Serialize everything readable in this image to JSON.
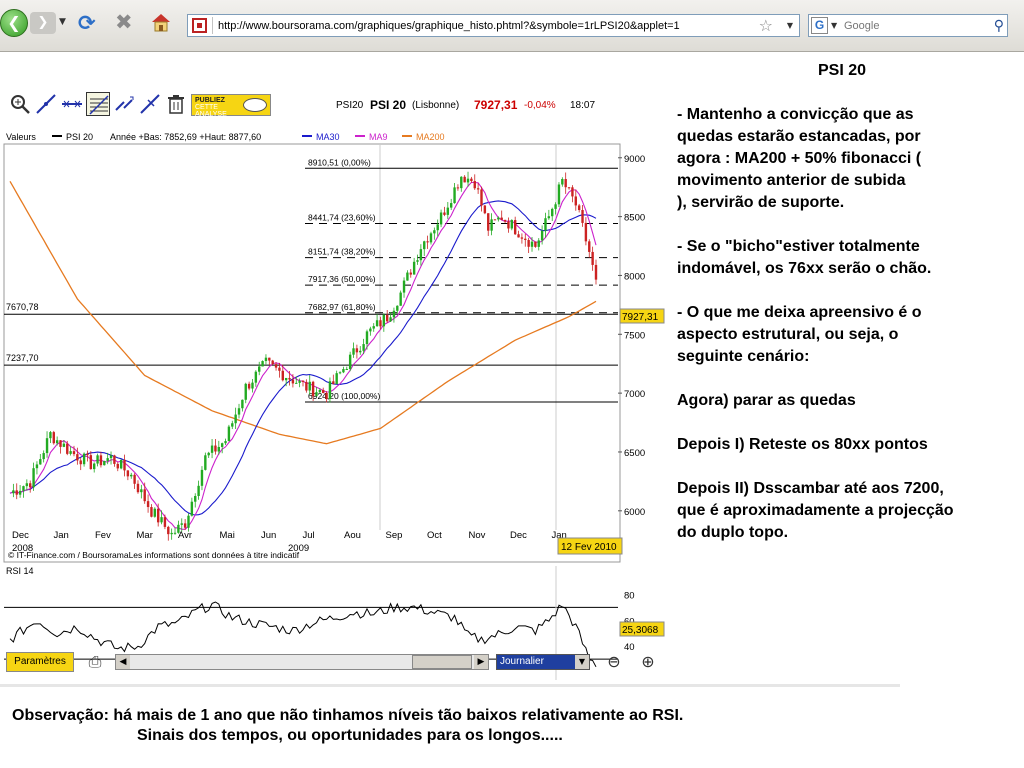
{
  "browser": {
    "url": "http://www.boursorama.com/graphiques/graphique_histo.phtml?&symbole=1rLPSI20&applet=1",
    "search_placeholder": "Google",
    "search_engine_icon": "G"
  },
  "chart_toolbar": {
    "publiez_line1": "PUBLIEZ",
    "publiez_line2": "CETTE",
    "publiez_line3": "ANALYSE",
    "symbol_code": "PSI20",
    "name": "PSI 20",
    "market": "(Lisbonne)",
    "price": "7927,31",
    "change": "-0,04%",
    "time": "18:07",
    "price_color": "#cc0000"
  },
  "chart_bottom": {
    "params_label": "Paramètres",
    "period_value": "Journalier"
  },
  "chart_data": {
    "type": "line",
    "header": {
      "valeurs": "Valeurs",
      "series_name": "PSI 20",
      "range_text": "Année +Bas: 7852,69 +Haut: 8877,60",
      "ma30": "MA30",
      "ma9": "MA9",
      "ma200": "MA200"
    },
    "colors": {
      "price_up": "#22aa22",
      "price_down": "#cc2222",
      "ma30": "#1a1acc",
      "ma9": "#cc22cc",
      "ma200": "#e67a20",
      "rsi": "#000000"
    },
    "x_month_labels": [
      "Dec",
      "Jan",
      "Fev",
      "Mar",
      "Avr",
      "Mai",
      "Jun",
      "Jul",
      "Aou",
      "Sep",
      "Oct",
      "Nov",
      "Dec",
      "Jan"
    ],
    "year_labels": [
      "2008",
      "2009"
    ],
    "y_ticks": [
      "9000",
      "8500",
      "8000",
      "7500",
      "7000",
      "6500",
      "6000"
    ],
    "ylim": [
      5650,
      9100
    ],
    "current_price_label": "7927,31",
    "date_label": "12 Fev 2010",
    "copyright": "© IT-Finance.com / BoursoramaLes informations sont données à titre indicatif",
    "fibonacci": [
      {
        "value": 8910.51,
        "label": "8910,51 (0,00%)"
      },
      {
        "value": 8441.74,
        "label": "8441,74 (23,60%)"
      },
      {
        "value": 8151.74,
        "label": "8151,74 (38,20%)"
      },
      {
        "value": 7917.36,
        "label": "7917,36 (50,00%)"
      },
      {
        "value": 7682.97,
        "label": "7682,97 (61,80%)"
      },
      {
        "value": 6924.2,
        "label": "6924,20 (100,00%)"
      }
    ],
    "support_lines": [
      {
        "value": 7670.78,
        "label": "7670,78"
      },
      {
        "value": 7237.7,
        "label": "7237,70"
      }
    ],
    "price_keypoints": [
      [
        0,
        6150
      ],
      [
        6,
        6250
      ],
      [
        12,
        6650
      ],
      [
        18,
        6500
      ],
      [
        24,
        6400
      ],
      [
        30,
        6450
      ],
      [
        36,
        6300
      ],
      [
        42,
        6000
      ],
      [
        48,
        5800
      ],
      [
        52,
        5900
      ],
      [
        58,
        6450
      ],
      [
        64,
        6600
      ],
      [
        70,
        7050
      ],
      [
        76,
        7250
      ],
      [
        82,
        7150
      ],
      [
        88,
        7050
      ],
      [
        94,
        7000
      ],
      [
        100,
        7250
      ],
      [
        106,
        7500
      ],
      [
        112,
        7650
      ],
      [
        116,
        7850
      ],
      [
        122,
        8250
      ],
      [
        128,
        8500
      ],
      [
        134,
        8850
      ],
      [
        138,
        8800
      ],
      [
        142,
        8400
      ],
      [
        146,
        8500
      ],
      [
        152,
        8350
      ],
      [
        156,
        8250
      ],
      [
        160,
        8500
      ],
      [
        164,
        8800
      ],
      [
        168,
        8600
      ],
      [
        172,
        8200
      ],
      [
        174,
        7930
      ]
    ],
    "ma200_keypoints": [
      [
        0,
        8800
      ],
      [
        20,
        7800
      ],
      [
        40,
        7150
      ],
      [
        60,
        6850
      ],
      [
        80,
        6650
      ],
      [
        94,
        6570
      ],
      [
        110,
        6700
      ],
      [
        130,
        7100
      ],
      [
        150,
        7450
      ],
      [
        166,
        7650
      ],
      [
        174,
        7780
      ]
    ],
    "rsi": {
      "label": "RSI 14",
      "y_ticks": [
        "80",
        "60",
        "40"
      ],
      "ylim": [
        20,
        85
      ],
      "bands": [
        70,
        30
      ],
      "current_label": "25,3068",
      "keypoints": [
        [
          0,
          45
        ],
        [
          8,
          60
        ],
        [
          14,
          50
        ],
        [
          20,
          55
        ],
        [
          26,
          45
        ],
        [
          32,
          38
        ],
        [
          38,
          40
        ],
        [
          44,
          55
        ],
        [
          50,
          58
        ],
        [
          56,
          68
        ],
        [
          60,
          72
        ],
        [
          66,
          62
        ],
        [
          72,
          58
        ],
        [
          78,
          55
        ],
        [
          84,
          52
        ],
        [
          90,
          58
        ],
        [
          96,
          62
        ],
        [
          102,
          66
        ],
        [
          108,
          65
        ],
        [
          114,
          70
        ],
        [
          120,
          70
        ],
        [
          126,
          66
        ],
        [
          132,
          62
        ],
        [
          136,
          48
        ],
        [
          140,
          45
        ],
        [
          146,
          50
        ],
        [
          150,
          55
        ],
        [
          156,
          52
        ],
        [
          160,
          60
        ],
        [
          164,
          72
        ],
        [
          168,
          55
        ],
        [
          172,
          30
        ],
        [
          174,
          26
        ]
      ]
    }
  },
  "commentary": {
    "title": "PSI 20",
    "p1": " - Mantenho a convicção que as\nquedas estarão estancadas, por\nagora : MA200 + 50% fibonacci (\nmovimento anterior de subida\n), servirão de suporte.",
    "p2": " - Se o \"bicho\"estiver totalmente\nindomável, os 76xx serão o chão.",
    "p3": " - O que me deixa apreensivo é o\naspecto estrutural, ou seja, o\nseguinte cenário:",
    "p4": "Agora) parar as quedas",
    "p5": "Depois I) Reteste os 80xx pontos",
    "p6": "Depois II) Dsscambar até aos 7200,\nque é aproximadamente a projecção\ndo duplo topo."
  },
  "observation": {
    "line1": "Observação: há mais de 1 ano que não tinhamos níveis tão baixos relativamente ao RSI.",
    "line2": "Sinais dos tempos, ou oportunidades para os longos....."
  }
}
